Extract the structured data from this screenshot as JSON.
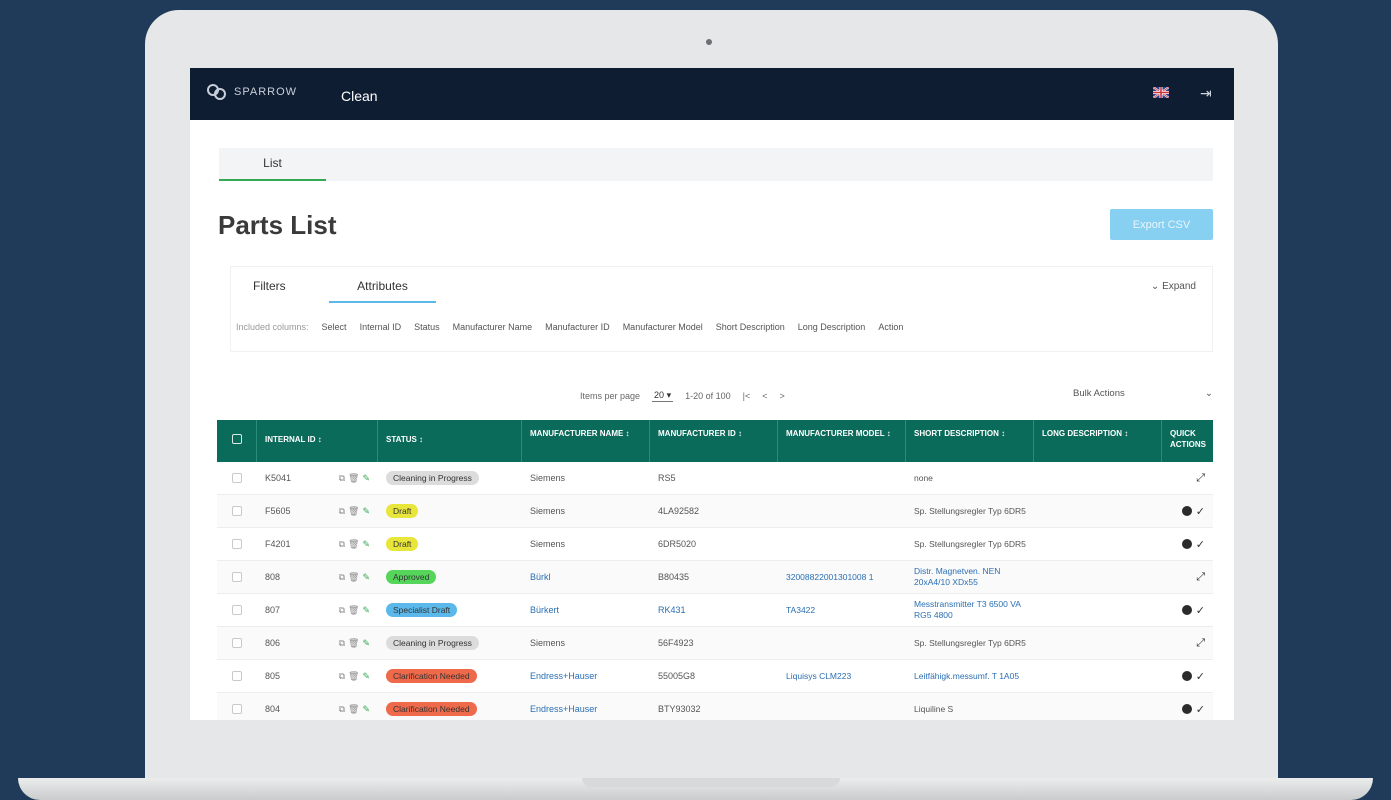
{
  "app": {
    "brand": "SPARROW",
    "title": "Clean"
  },
  "tabs": [
    {
      "label": "List"
    }
  ],
  "page": {
    "title": "Parts List",
    "export_label": "Export CSV"
  },
  "filter_panel": {
    "tabs": [
      "Filters",
      "Attributes"
    ],
    "expand_label": "Expand",
    "attributes": [
      "Included columns:",
      "Select",
      "Internal ID",
      "Status",
      "Manufacturer Name",
      "Manufacturer ID",
      "Manufacturer Model",
      "Short Description",
      "Long Description",
      "Action"
    ]
  },
  "paging": {
    "items_per_page_label": "Items per page",
    "items_per_page": "20",
    "range": "1-20 of 100",
    "first": "|<",
    "prev": "<",
    "next": ">"
  },
  "bulk_actions": {
    "label": "Bulk Actions",
    "chevron": "⌄"
  },
  "table": {
    "columns": [
      "INTERNAL ID ↕",
      "STATUS ↕",
      "MANUFACTURER NAME ↕",
      "MANUFACTURER ID ↕",
      "MANUFACTURER MODEL ↕",
      "SHORT DESCRIPTION ↕",
      "LONG DESCRIPTION ↕",
      "QUICK ACTIONS"
    ],
    "rows": [
      {
        "id": "K5041",
        "status": "Cleaning in Progress",
        "status_color": "#dcdcdc",
        "mfr_name": "Siemens",
        "mfr_name_link": false,
        "mfr_id": "RS5",
        "mfr_id_link": false,
        "model": "",
        "short": "none",
        "short_link": false,
        "action": "expand"
      },
      {
        "id": "F5605",
        "status": "Draft",
        "status_color": "#e8e63a",
        "mfr_name": "Siemens",
        "mfr_name_link": false,
        "mfr_id": "4LA92582",
        "mfr_id_link": false,
        "model": "",
        "short": "Sp. Stellungsregler Typ 6DR5",
        "short_link": false,
        "action": "dot-check"
      },
      {
        "id": "F4201",
        "status": "Draft",
        "status_color": "#e8e63a",
        "mfr_name": "Siemens",
        "mfr_name_link": false,
        "mfr_id": "6DR5020",
        "mfr_id_link": false,
        "model": "",
        "short": "Sp. Stellungsregler Typ 6DR5",
        "short_link": false,
        "action": "dot-check"
      },
      {
        "id": "808",
        "status": "Approved",
        "status_color": "#55d65a",
        "mfr_name": "Bürkl",
        "mfr_name_link": true,
        "mfr_id": "B80435",
        "mfr_id_link": false,
        "model": "32008822001301008 1",
        "model_link": true,
        "short": "Distr. Magnetven. NEN 20xA4/10 XDx55",
        "short_link": true,
        "action": "expand"
      },
      {
        "id": "807",
        "status": "Specialist Draft",
        "status_color": "#5ab9ea",
        "mfr_name": "Bürkert",
        "mfr_name_link": true,
        "mfr_id": "RK431",
        "mfr_id_link": true,
        "model": "TA3422",
        "model_link": true,
        "short": "Messtransmitter T3 6500 VA RG5 4800",
        "short_link": true,
        "action": "dot-check"
      },
      {
        "id": "806",
        "status": "Cleaning in Progress",
        "status_color": "#dcdcdc",
        "mfr_name": "Siemens",
        "mfr_name_link": false,
        "mfr_id": "56F4923",
        "mfr_id_link": false,
        "model": "",
        "short": "Sp. Stellungsregler Typ 6DR5",
        "short_link": false,
        "action": "expand"
      },
      {
        "id": "805",
        "status": "Clarification Needed",
        "status_color": "#ef6a4a",
        "mfr_name": "Endress+Hauser",
        "mfr_name_link": true,
        "mfr_id": "55005G8",
        "mfr_id_link": false,
        "model": "Liquisys CLM223",
        "model_link": true,
        "short": "Leitfähigk.messumf. T 1A05",
        "short_link": true,
        "action": "dot-check"
      },
      {
        "id": "804",
        "status": "Clarification Needed",
        "status_color": "#ef6a4a",
        "mfr_name": "Endress+Hauser",
        "mfr_name_link": true,
        "mfr_id": "BTY93032",
        "mfr_id_link": false,
        "model": "",
        "short": "Liquiline S",
        "short_link": false,
        "action": "dot-check"
      }
    ]
  },
  "colors": {
    "nav_bg": "#0f1d33",
    "table_header": "#0b6b5a",
    "accent_green": "#34a853",
    "accent_blue": "#5ab9ea",
    "background": "#203a5a"
  },
  "icons": {
    "logo": "sparrow-logo-icon",
    "flag": "uk-flag-icon",
    "logout": "logout-icon",
    "row": [
      "copy-icon",
      "delete-icon",
      "edit-icon"
    ],
    "expand": "expand-arrows-icon",
    "check": "check-icon"
  }
}
